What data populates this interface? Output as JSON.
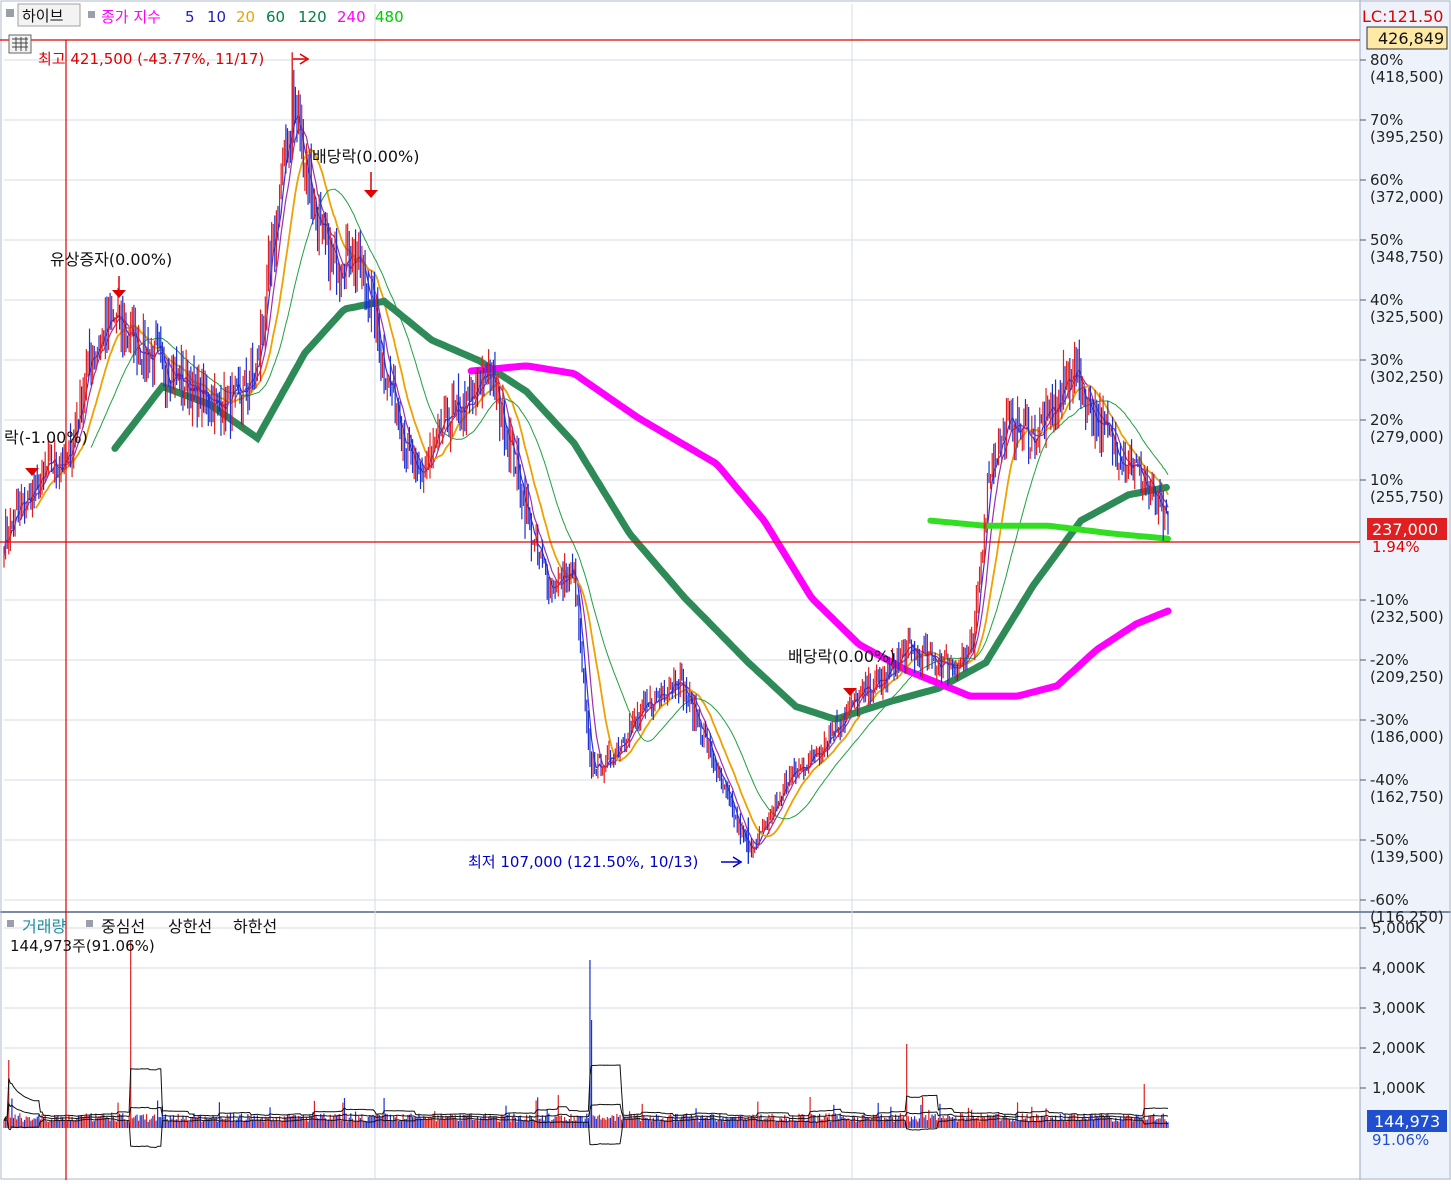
{
  "price_panel": {
    "legend": {
      "ticker": "하이브",
      "indicator": "종가 지수",
      "ma_periods": [
        {
          "label": "5",
          "color": "#2020c0"
        },
        {
          "label": "10",
          "color": "#2020c0"
        },
        {
          "label": "20",
          "color": "#f0a000"
        },
        {
          "label": "60",
          "color": "#008040"
        },
        {
          "label": "120",
          "color": "#008040"
        },
        {
          "label": "240",
          "color": "#ff00ff"
        },
        {
          "label": "480",
          "color": "#00cc00"
        }
      ],
      "indicator_color": "#ff00ff"
    },
    "lc_label": "LC:121.50",
    "top_price_box": "426,849",
    "current_price_box": "237,000",
    "current_change": "1.94%",
    "annotations": {
      "high": "최고 421,500 (-43.77%, 11/17)",
      "low": "최저 107,000 (121.50%, 10/13)",
      "rights": "유상증자(0.00%)",
      "dividend1": "배당락(0.00%)",
      "dividend2": "배당락(0.00%)",
      "left_partial": "락(-1.00%)"
    }
  },
  "volume_panel": {
    "legend": {
      "title": "거래량",
      "center": "중심선",
      "upper": "상한선",
      "lower": "하한선",
      "value": "144,973주(91.06%)"
    },
    "current_box": "144,973",
    "current_pct": "91.06%"
  },
  "chart_data": [
    {
      "type": "candlestick",
      "title": "하이브",
      "y_axis_pct_ticks": [
        "80%",
        "70%",
        "60%",
        "50%",
        "40%",
        "30%",
        "20%",
        "10%",
        "-10%",
        "-20%",
        "-30%",
        "-40%",
        "-50%",
        "-60%"
      ],
      "y_axis_price_ticks": [
        "(418,500)",
        "(395,250)",
        "(372,000)",
        "(348,750)",
        "(325,500)",
        "(302,250)",
        "(279,000)",
        "(255,750)",
        "(232,500)",
        "(209,250)",
        "(186,000)",
        "(162,750)",
        "(139,500)",
        "(116,250)",
        ""
      ],
      "ylim": [
        90000,
        440000
      ],
      "high": 421500,
      "low": 107000,
      "last_close": 237000,
      "close_series": [
        {
          "t": 0,
          "v": 232000
        },
        {
          "t": 10,
          "v": 245000
        },
        {
          "t": 20,
          "v": 252000
        },
        {
          "t": 30,
          "v": 262000
        },
        {
          "t": 40,
          "v": 262000
        },
        {
          "t": 55,
          "v": 305000
        },
        {
          "t": 70,
          "v": 318000
        },
        {
          "t": 90,
          "v": 305000
        },
        {
          "t": 105,
          "v": 298000
        },
        {
          "t": 120,
          "v": 290000
        },
        {
          "t": 135,
          "v": 285000
        },
        {
          "t": 150,
          "v": 288000
        },
        {
          "t": 160,
          "v": 300000
        },
        {
          "t": 175,
          "v": 370000
        },
        {
          "t": 182,
          "v": 400000
        },
        {
          "t": 190,
          "v": 380000
        },
        {
          "t": 200,
          "v": 350000
        },
        {
          "t": 210,
          "v": 340000
        },
        {
          "t": 220,
          "v": 345000
        },
        {
          "t": 230,
          "v": 330000
        },
        {
          "t": 240,
          "v": 300000
        },
        {
          "t": 250,
          "v": 280000
        },
        {
          "t": 260,
          "v": 255000
        },
        {
          "t": 270,
          "v": 265000
        },
        {
          "t": 280,
          "v": 280000
        },
        {
          "t": 295,
          "v": 285000
        },
        {
          "t": 305,
          "v": 300000
        },
        {
          "t": 320,
          "v": 270000
        },
        {
          "t": 335,
          "v": 230000
        },
        {
          "t": 345,
          "v": 215000
        },
        {
          "t": 360,
          "v": 220000
        },
        {
          "t": 370,
          "v": 145000
        },
        {
          "t": 380,
          "v": 145000
        },
        {
          "t": 395,
          "v": 160000
        },
        {
          "t": 410,
          "v": 170000
        },
        {
          "t": 425,
          "v": 180000
        },
        {
          "t": 440,
          "v": 160000
        },
        {
          "t": 455,
          "v": 135000
        },
        {
          "t": 470,
          "v": 112000
        },
        {
          "t": 480,
          "v": 120000
        },
        {
          "t": 495,
          "v": 140000
        },
        {
          "t": 510,
          "v": 148000
        },
        {
          "t": 525,
          "v": 160000
        },
        {
          "t": 540,
          "v": 172000
        },
        {
          "t": 555,
          "v": 178000
        },
        {
          "t": 570,
          "v": 190000
        },
        {
          "t": 585,
          "v": 186000
        },
        {
          "t": 600,
          "v": 184000
        },
        {
          "t": 612,
          "v": 190000
        },
        {
          "t": 622,
          "v": 260000
        },
        {
          "t": 635,
          "v": 278000
        },
        {
          "t": 650,
          "v": 272000
        },
        {
          "t": 665,
          "v": 285000
        },
        {
          "t": 675,
          "v": 300000
        },
        {
          "t": 685,
          "v": 285000
        },
        {
          "t": 700,
          "v": 270000
        },
        {
          "t": 715,
          "v": 260000
        },
        {
          "t": 725,
          "v": 250000
        },
        {
          "t": 735,
          "v": 237000
        }
      ],
      "ma60": [
        {
          "t": 70,
          "v": 268000
        },
        {
          "t": 100,
          "v": 292000
        },
        {
          "t": 130,
          "v": 285000
        },
        {
          "t": 160,
          "v": 272000
        },
        {
          "t": 190,
          "v": 305000
        },
        {
          "t": 215,
          "v": 322000
        },
        {
          "t": 240,
          "v": 325000
        },
        {
          "t": 270,
          "v": 310000
        },
        {
          "t": 300,
          "v": 302000
        },
        {
          "t": 330,
          "v": 290000
        },
        {
          "t": 360,
          "v": 270000
        },
        {
          "t": 395,
          "v": 235000
        },
        {
          "t": 430,
          "v": 210000
        },
        {
          "t": 470,
          "v": 185000
        },
        {
          "t": 500,
          "v": 168000
        },
        {
          "t": 525,
          "v": 163000
        },
        {
          "t": 560,
          "v": 170000
        },
        {
          "t": 590,
          "v": 175000
        },
        {
          "t": 620,
          "v": 185000
        },
        {
          "t": 650,
          "v": 215000
        },
        {
          "t": 680,
          "v": 240000
        },
        {
          "t": 710,
          "v": 250000
        },
        {
          "t": 735,
          "v": 253000
        }
      ],
      "ma240": [
        {
          "t": 295,
          "v": 298000
        },
        {
          "t": 330,
          "v": 300000
        },
        {
          "t": 360,
          "v": 297000
        },
        {
          "t": 400,
          "v": 280000
        },
        {
          "t": 450,
          "v": 262000
        },
        {
          "t": 480,
          "v": 240000
        },
        {
          "t": 510,
          "v": 210000
        },
        {
          "t": 540,
          "v": 192000
        },
        {
          "t": 570,
          "v": 182000
        },
        {
          "t": 610,
          "v": 172000
        },
        {
          "t": 640,
          "v": 172000
        },
        {
          "t": 665,
          "v": 176000
        },
        {
          "t": 690,
          "v": 190000
        },
        {
          "t": 715,
          "v": 200000
        },
        {
          "t": 735,
          "v": 205000
        }
      ],
      "ma480": [
        {
          "t": 585,
          "v": 240000
        },
        {
          "t": 620,
          "v": 238000
        },
        {
          "t": 660,
          "v": 238000
        },
        {
          "t": 700,
          "v": 235000
        },
        {
          "t": 735,
          "v": 233000
        }
      ]
    },
    {
      "type": "bar",
      "title": "거래량",
      "y_axis_ticks": [
        "5,000K",
        "4,000K",
        "3,000K",
        "2,000K",
        "1,000K"
      ],
      "ylim": [
        0,
        5000
      ],
      "last_value": 144.973,
      "spikes": [
        {
          "t": 80,
          "v": 4700
        },
        {
          "t": 370,
          "v": 4200
        },
        {
          "t": 371,
          "v": 2700
        },
        {
          "t": 570,
          "v": 2100
        },
        {
          "t": 720,
          "v": 1100
        },
        {
          "t": 3,
          "v": 1700
        }
      ]
    }
  ]
}
